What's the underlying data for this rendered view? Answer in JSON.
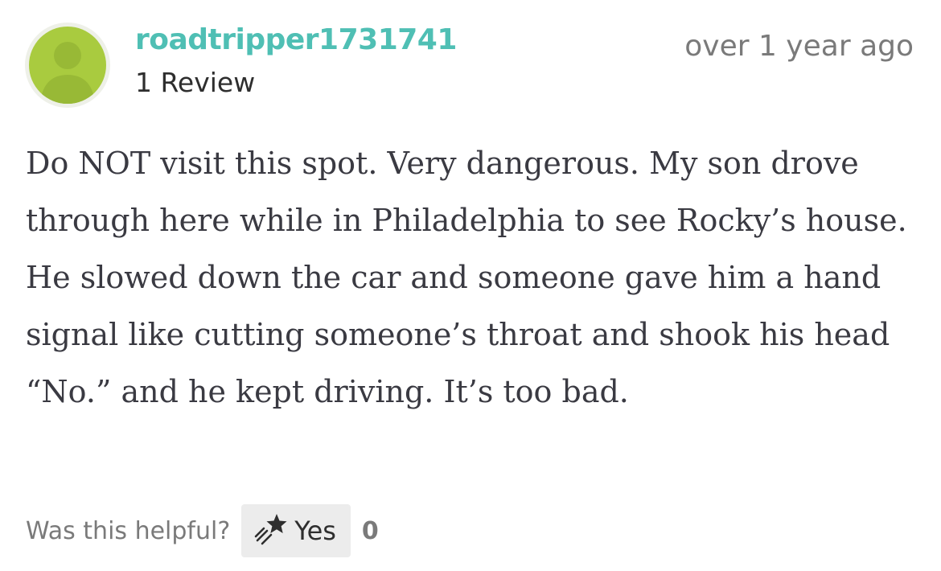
{
  "review": {
    "username": "roadtripper1731741",
    "review_count": "1 Review",
    "timestamp": "over 1 year ago",
    "body": "Do NOT visit this spot. Very dangerous. My son drove through here while in Philadelphia to see Rocky’s house. He slowed down the car and someone gave him a hand signal like cutting someone’s throat and shook his head “No.” and he kept driving. It’s too bad.",
    "avatar_icon": "default-user-silhouette-icon"
  },
  "helpful": {
    "prompt": "Was this helpful?",
    "yes_label": "Yes",
    "yes_icon": "shooting-star-icon",
    "yes_count": "0"
  },
  "colors": {
    "username": "#4fbfb4",
    "avatar_bg": "#a9cb3f",
    "body_text": "#3a3a42",
    "muted_text": "#7a7a7a",
    "button_bg": "#ececec"
  }
}
